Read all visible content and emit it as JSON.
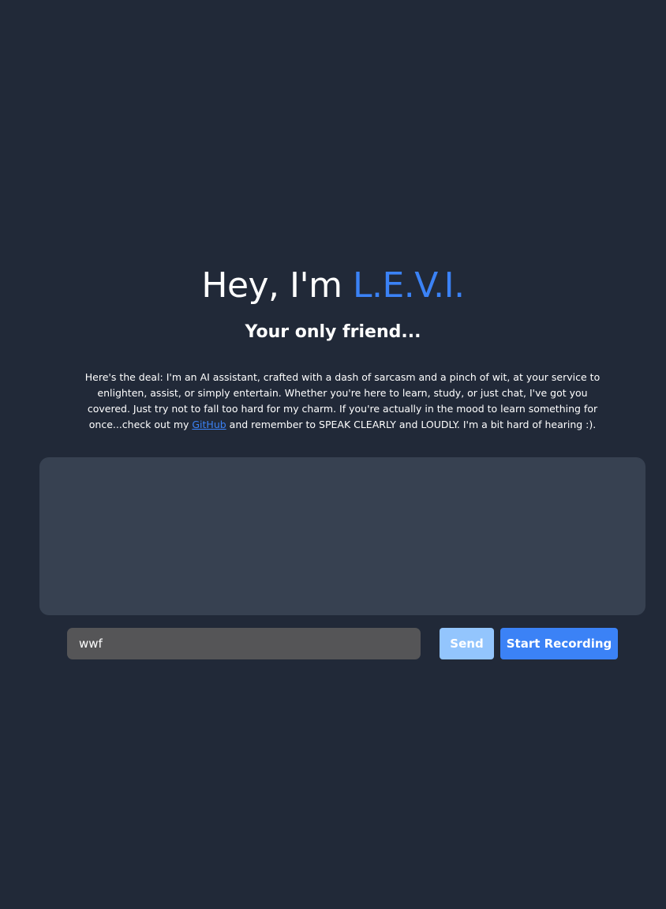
{
  "hero": {
    "title_prefix": "Hey, I'm ",
    "title_accent": "L.E.V.I.",
    "subtitle": "Your only friend..."
  },
  "intro": {
    "text_before_link": "Here's the deal: I'm an AI assistant, crafted with a dash of sarcasm and a pinch of wit, at your service to enlighten, assist, or simply entertain. Whether you're here to learn, study, or just chat, I've got you covered. Just try not to fall too hard for my charm. If you're actually in the mood to learn something for once...check out my ",
    "link_label": "GitHub",
    "text_after_link": " and remember to SPEAK CLEARLY and LOUDLY. I'm a bit hard of hearing :)."
  },
  "input": {
    "value": "wwf"
  },
  "buttons": {
    "send_label": "Send",
    "record_label": "Start Recording"
  },
  "colors": {
    "background": "#212938",
    "accent": "#3b82f6",
    "chat_panel": "#374151",
    "input_bg": "#555557",
    "send_disabled": "#93c5fd"
  }
}
